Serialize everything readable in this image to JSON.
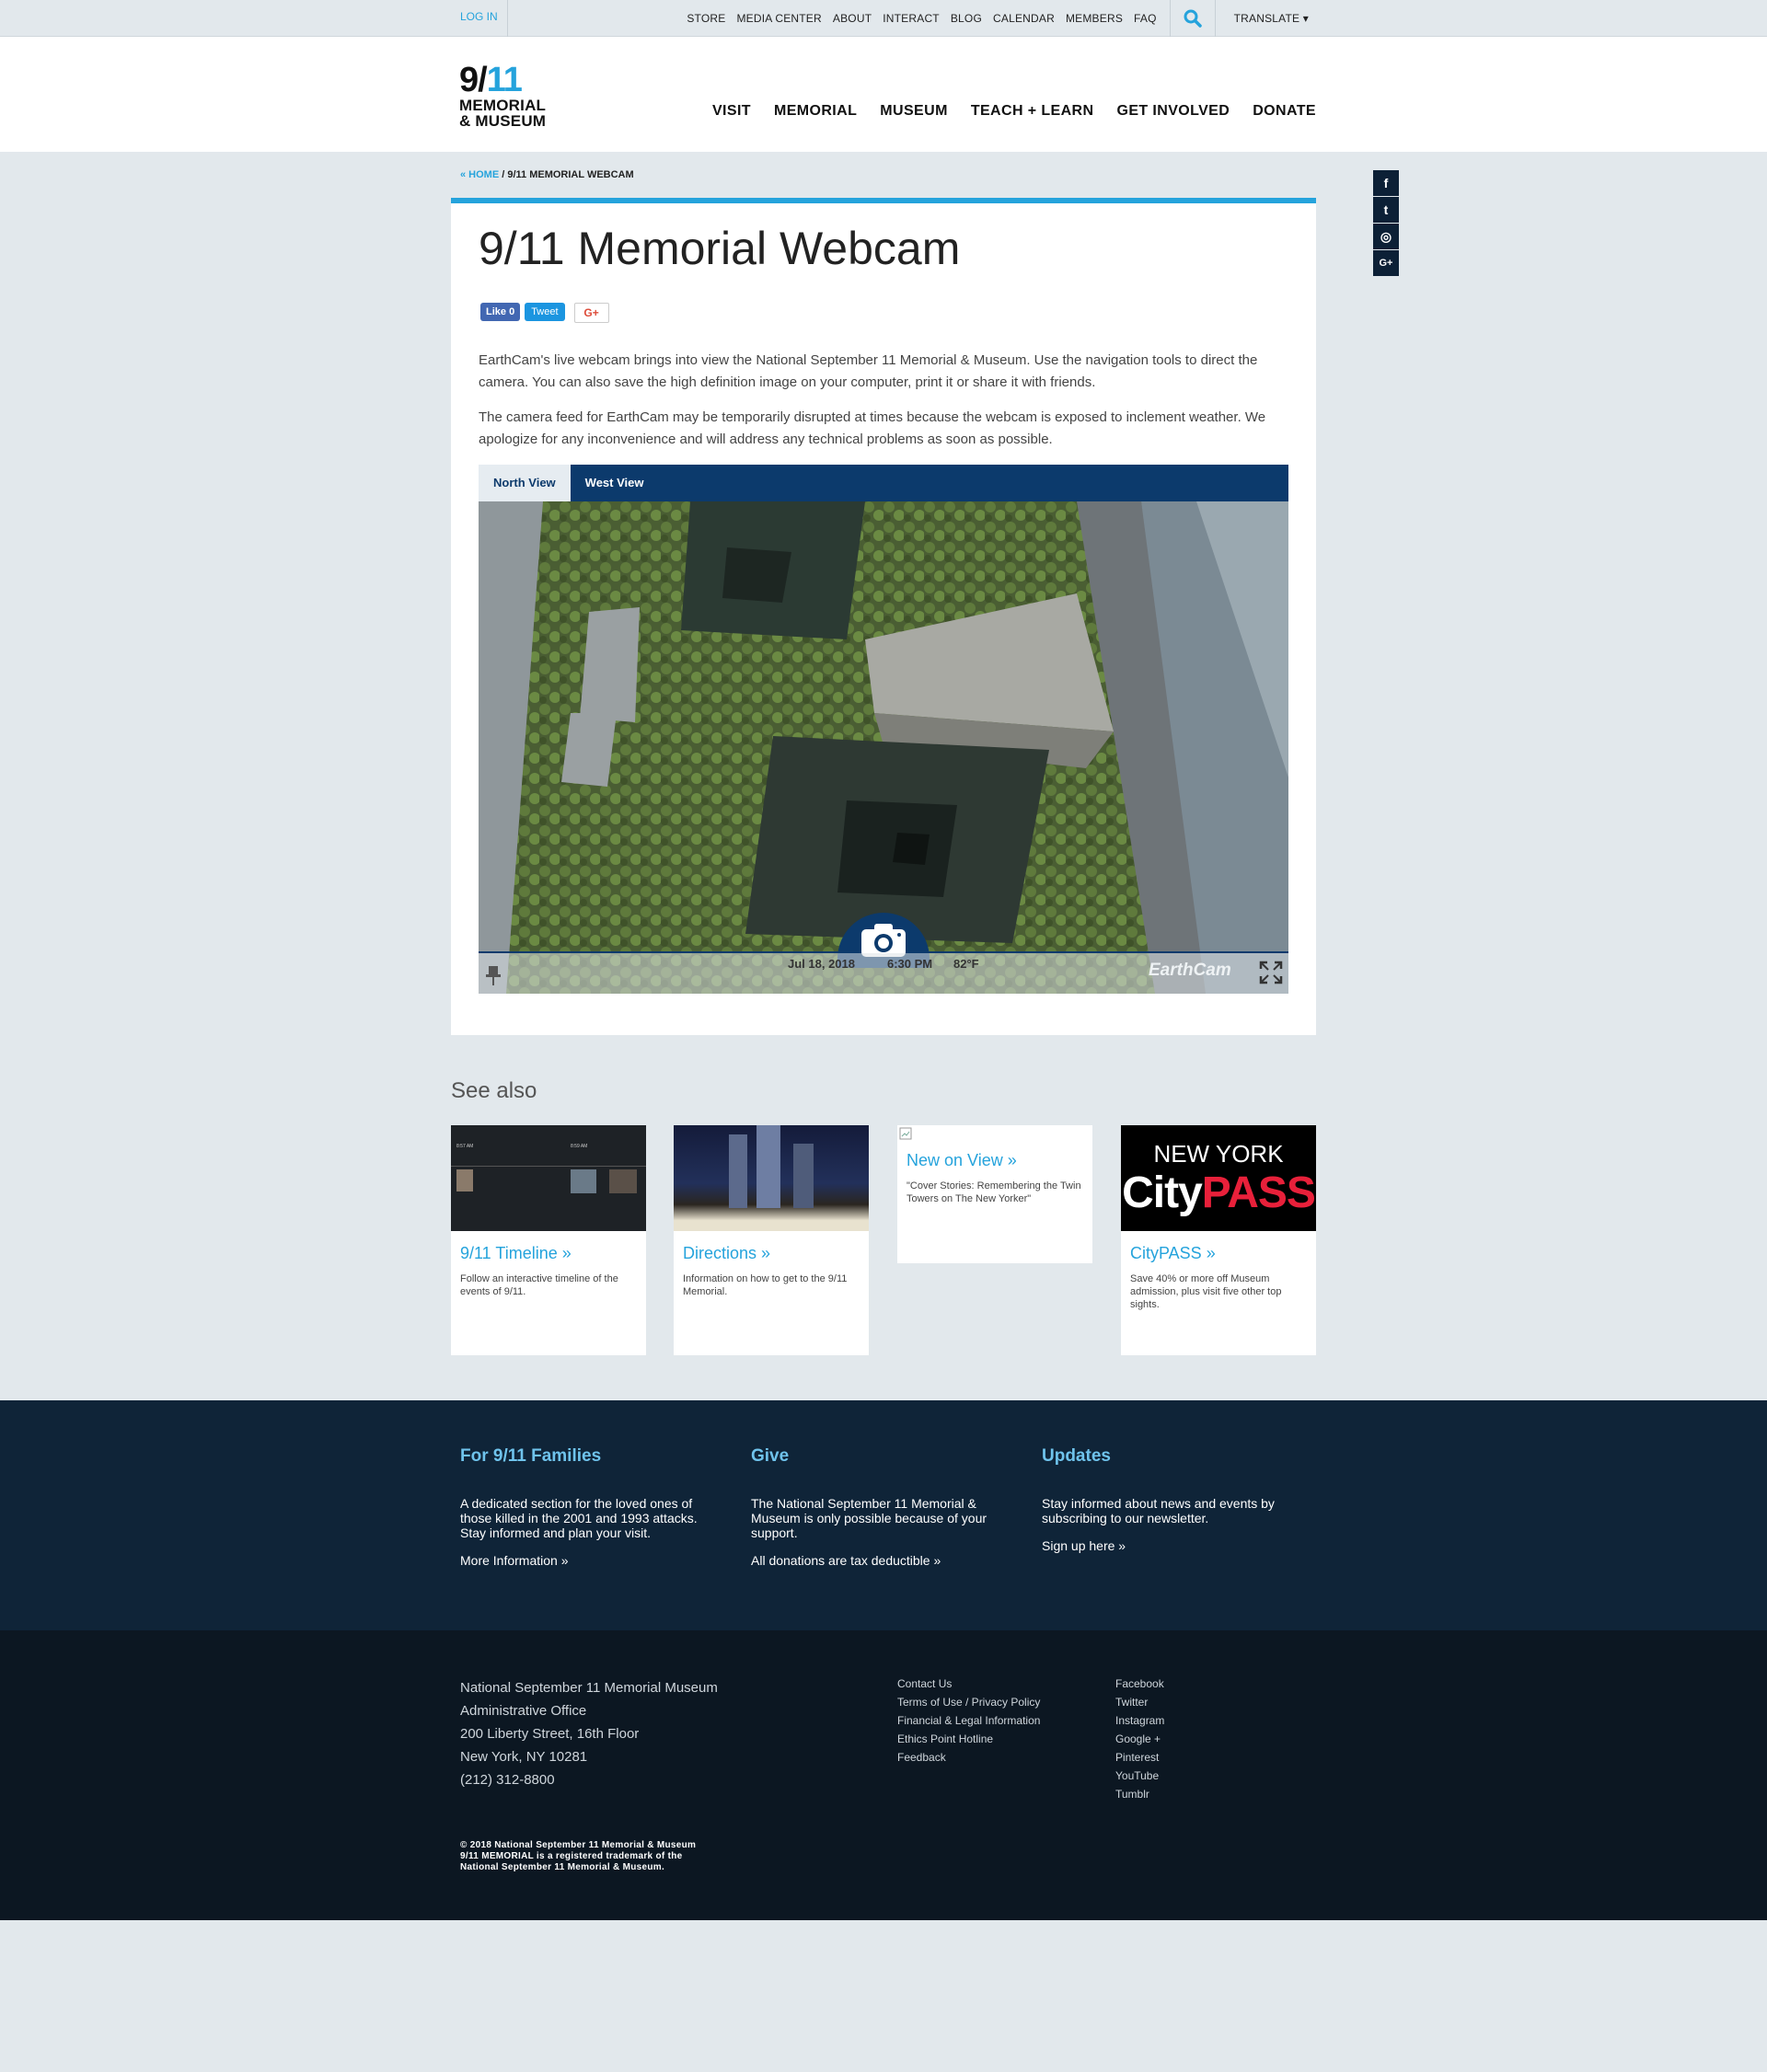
{
  "topbar": {
    "login": "LOG IN",
    "links": [
      "STORE",
      "MEDIA CENTER",
      "ABOUT",
      "INTERACT",
      "BLOG",
      "CALENDAR",
      "MEMBERS",
      "FAQ"
    ],
    "translate": "TRANSLATE ▾"
  },
  "logo": {
    "num_a": "9/",
    "num_b": "11",
    "line1": "MEMORIAL",
    "line2": "& MUSEUM"
  },
  "mainnav": [
    "VISIT",
    "MEMORIAL",
    "MUSEUM",
    "TEACH + LEARN",
    "GET INVOLVED",
    "DONATE"
  ],
  "breadcrumb": {
    "home": "« HOME",
    "current": " / 9/11 MEMORIAL WEBCAM"
  },
  "social_side": [
    "f",
    "t",
    "◎",
    "G+"
  ],
  "page": {
    "title": "9/11 Memorial Webcam",
    "like": "Like 0",
    "tweet": "Tweet",
    "gplus": "G+",
    "para1": "EarthCam's live webcam brings into view the National September 11 Memorial & Museum. Use the navigation tools to direct the camera. You can also save the high definition image on your computer, print it or share it with friends.",
    "para2": "The camera feed for EarthCam may be temporarily disrupted at times because the webcam is exposed to inclement weather. We apologize for any inconvenience and will address any technical problems as soon as possible."
  },
  "tabs": [
    "North View",
    "West View"
  ],
  "cam": {
    "date": "Jul 18, 2018",
    "time": "6:30 PM",
    "temp": "82°F",
    "brand": "EarthCam"
  },
  "seealso": {
    "heading": "See also",
    "tiles": [
      {
        "title": "9/11 Timeline »",
        "desc": "Follow an interactive timeline of the events of 9/11."
      },
      {
        "title": "Directions »",
        "desc": "Information on how to get to the 9/11 Memorial."
      },
      {
        "title": "New on View »",
        "desc": "\"Cover Stories: Remembering the Twin Towers on The New Yorker\""
      },
      {
        "title": "CityPASS »",
        "desc": "Save 40% or more off Museum admission, plus visit five other top sights."
      }
    ],
    "citypass_a": "NEW YORK",
    "citypass_b": "City",
    "citypass_c": "PASS",
    "timeline_t1": "8:57 AM",
    "timeline_t2": "8:59 AM"
  },
  "footer": {
    "cols": [
      {
        "title": "For 9/11 Families",
        "text": "A dedicated section for the loved ones of those killed in the 2001 and 1993 attacks. Stay informed and plan your visit.",
        "link": "More Information »"
      },
      {
        "title": "Give",
        "text": "The National September 11 Memorial & Museum is only possible because of your support.",
        "link": "All donations are tax deductible »"
      },
      {
        "title": "Updates",
        "text": "Stay informed about news and events by subscribing to our newsletter.",
        "link": "Sign up here »"
      }
    ],
    "address": [
      "National September 11 Memorial Museum",
      "Administrative Office",
      "200 Liberty Street, 16th Floor",
      "New York, NY 10281",
      "(212) 312-8800"
    ],
    "links1": [
      "Contact Us",
      "Terms of Use / Privacy Policy",
      "Financial & Legal Information",
      "Ethics Point Hotline",
      "Feedback"
    ],
    "links2": [
      "Facebook",
      "Twitter",
      "Instagram",
      "Google +",
      "Pinterest",
      "YouTube",
      "Tumblr"
    ],
    "copyright": [
      "© 2018 National September 11 Memorial & Museum",
      "9/11 MEMORIAL is a registered trademark of the",
      "National September 11 Memorial & Museum."
    ]
  },
  "colors": {
    "accent": "#25a3dc",
    "navy": "#0c3a6c",
    "footer": "#0f2438",
    "footer_dark": "#0c1722"
  }
}
